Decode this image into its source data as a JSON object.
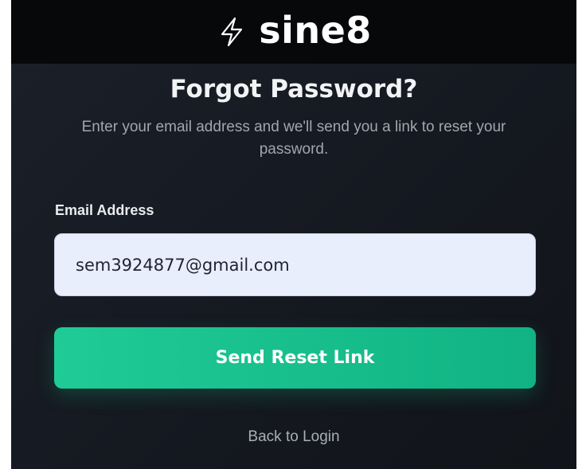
{
  "brand": {
    "name": "sine8",
    "icon": "lightning-bolt-icon"
  },
  "form": {
    "title": "Forgot Password?",
    "subtitle": "Enter your email address and we'll send you a link to reset your password.",
    "email_label": "Email Address",
    "email_value": "sem3924877@gmail.com",
    "submit_label": "Send Reset Link",
    "back_link": "Back to Login"
  },
  "colors": {
    "accent": "#10b981",
    "background": "#12151c",
    "header": "#070809"
  }
}
